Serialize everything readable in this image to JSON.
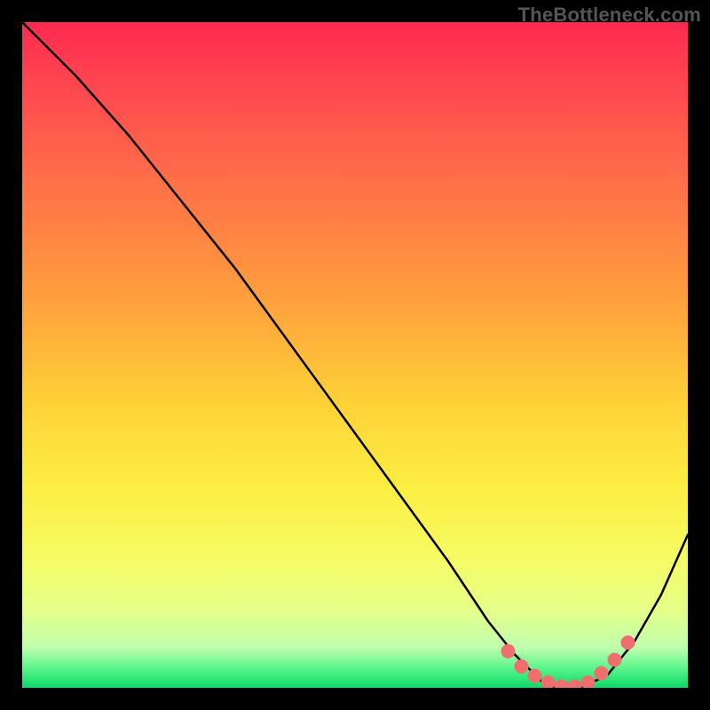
{
  "attribution": "TheBottleneck.com",
  "chart_data": {
    "type": "line",
    "title": "",
    "xlabel": "",
    "ylabel": "",
    "xlim": [
      0,
      100
    ],
    "ylim": [
      0,
      100
    ],
    "series": [
      {
        "name": "bottleneck-curve",
        "x": [
          0,
          8,
          16,
          24,
          32,
          40,
          48,
          56,
          64,
          70,
          74,
          78,
          80,
          84,
          88,
          92,
          96,
          100
        ],
        "y": [
          100,
          92,
          83,
          73,
          63,
          52,
          41,
          30,
          19,
          10,
          5,
          1,
          0,
          0,
          2,
          7,
          14,
          23
        ]
      }
    ],
    "highlight": {
      "name": "optimal-range",
      "x": [
        73,
        75,
        77,
        79,
        81,
        83,
        85,
        87,
        89,
        91
      ],
      "y": [
        5.5,
        3.2,
        1.8,
        0.8,
        0.2,
        0.2,
        0.8,
        2.2,
        4.2,
        6.8
      ]
    },
    "colors": {
      "curve": "#000000",
      "highlight": "#ef6f6f",
      "gradient_top": "#ff2a4f",
      "gradient_bottom": "#0cd964"
    }
  }
}
